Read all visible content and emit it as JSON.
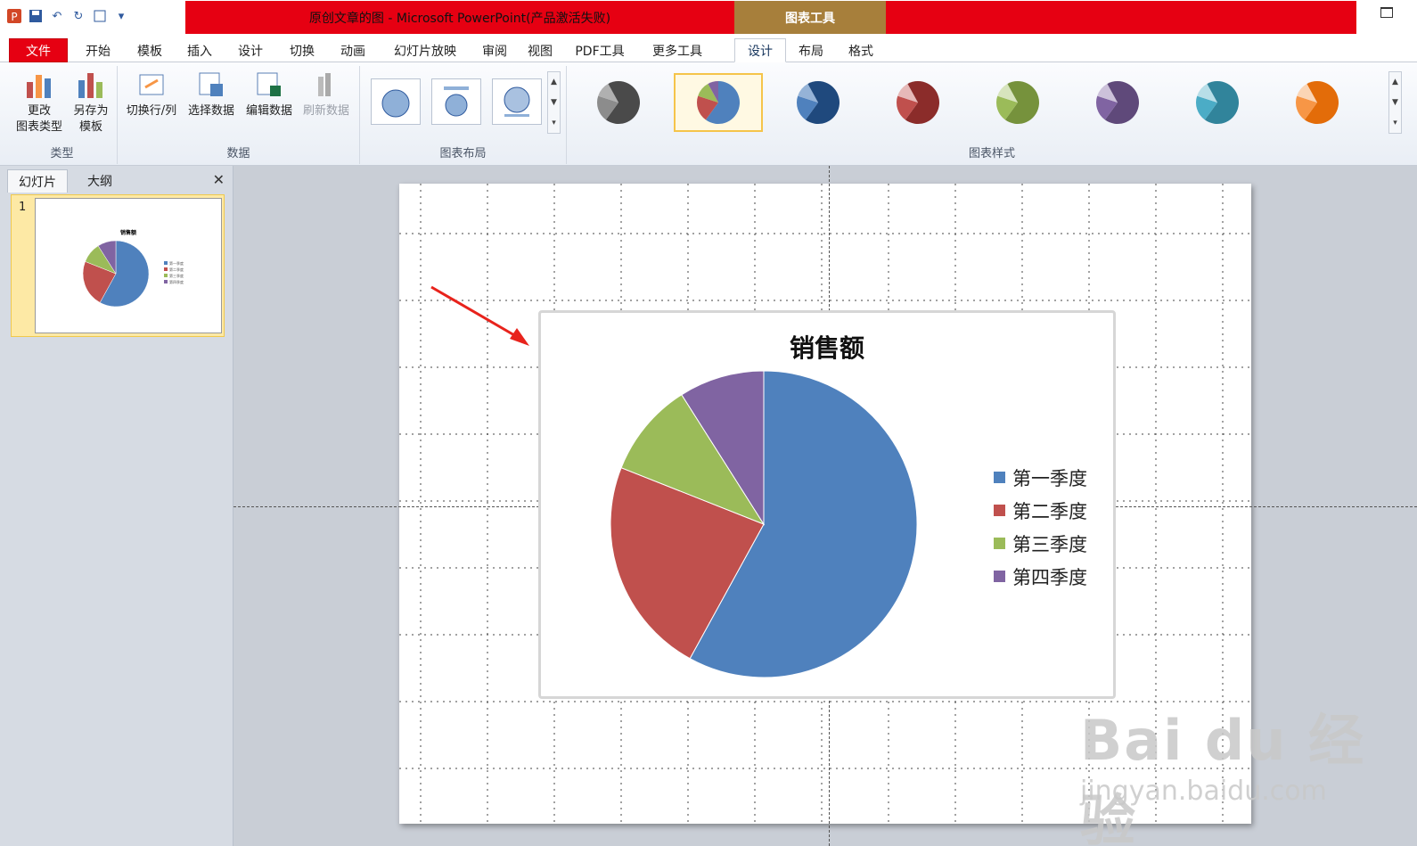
{
  "window": {
    "title": "原创文章的图 - Microsoft PowerPoint(产品激活失败)",
    "context_tab_group": "图表工具"
  },
  "tabs": [
    "文件",
    "开始",
    "模板",
    "插入",
    "设计",
    "切换",
    "动画",
    "幻灯片放映",
    "审阅",
    "视图",
    "PDF工具",
    "更多工具",
    "设计",
    "布局",
    "格式"
  ],
  "ribbon": {
    "type_group": {
      "label": "类型",
      "buttons": [
        "更改\n图表类型",
        "另存为\n模板"
      ]
    },
    "data_group": {
      "label": "数据",
      "buttons": [
        "切换行/列",
        "选择数据",
        "编辑数据",
        "刷新数据"
      ]
    },
    "layout_group": {
      "label": "图表布局"
    },
    "style_group": {
      "label": "图表样式",
      "selected_index": 1,
      "styles": [
        [
          "#4a4a4a",
          "#8c8c8c",
          "#b0b0b0"
        ],
        [
          "#4f81bd",
          "#c0504d",
          "#9bbb59",
          "#8064a2"
        ],
        [
          "#1f497d",
          "#4f81bd",
          "#95b3d7"
        ],
        [
          "#8b2c2a",
          "#c0504d",
          "#e6b9b8"
        ],
        [
          "#76923c",
          "#9bbb59",
          "#d7e4bd"
        ],
        [
          "#5f497a",
          "#8064a2",
          "#ccc1da"
        ],
        [
          "#31849b",
          "#4bacc6",
          "#b7dee8"
        ],
        [
          "#e36c09",
          "#f79646",
          "#fbd5b5"
        ]
      ]
    }
  },
  "slides_panel": {
    "tabs": [
      "幻灯片",
      "大纲"
    ],
    "slide_number": "1"
  },
  "chart_data": {
    "type": "pie",
    "title": "销售额",
    "categories": [
      "第一季度",
      "第二季度",
      "第三季度",
      "第四季度"
    ],
    "values": [
      58,
      23,
      10,
      9
    ],
    "colors": [
      "#4f81bd",
      "#c0504d",
      "#9bbb59",
      "#8064a2"
    ],
    "legend_position": "right"
  },
  "watermark": {
    "line1": "Bai  du 经验",
    "line2": "jingyan.baidu.com"
  }
}
